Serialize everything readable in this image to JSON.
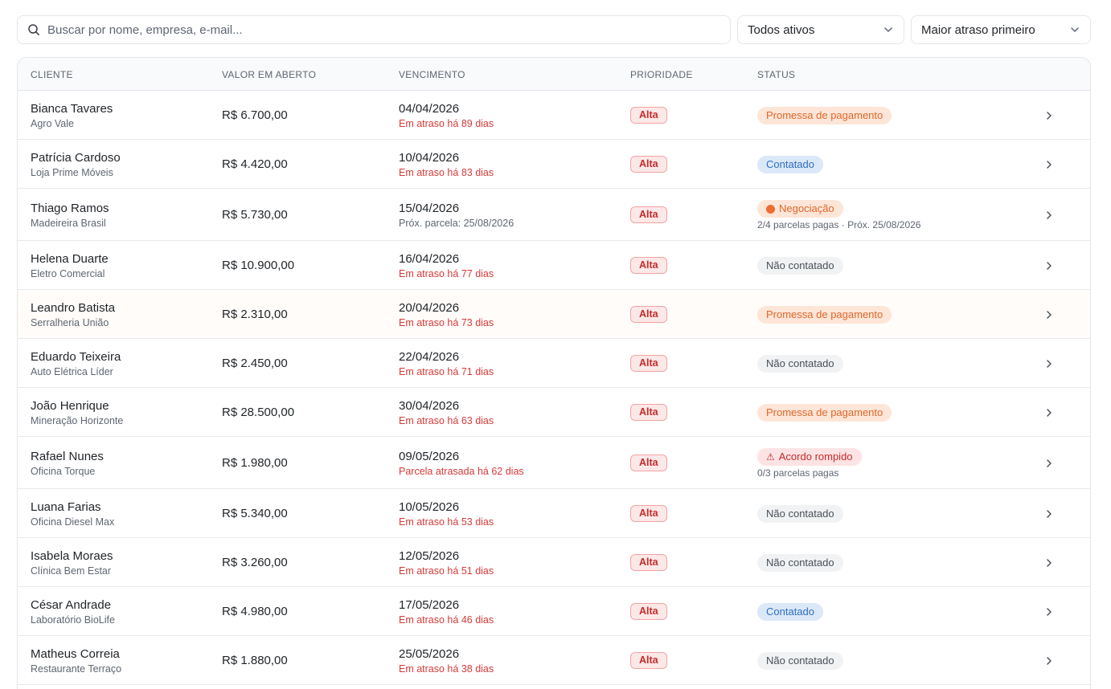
{
  "toolbar": {
    "search_placeholder": "Buscar por nome, empresa, e-mail...",
    "status_filter": "Todos ativos",
    "order_filter": "Maior atraso primeiro"
  },
  "columns": {
    "client": "CLIENTE",
    "amount": "VALOR EM ABERTO",
    "due": "VENCIMENTO",
    "priority": "PRIORIDADE",
    "status": "STATUS"
  },
  "rows": [
    {
      "name": "Bianca Tavares",
      "company": "Agro Vale",
      "amount": "R$ 6.700,00",
      "date": "04/04/2026",
      "due_note": "Em atraso há 89 dias",
      "due_tone": "red",
      "priority": "Alta",
      "status": "Promessa de pagamento",
      "status_kind": "promise",
      "status_sub": ""
    },
    {
      "name": "Patrícia Cardoso",
      "company": "Loja Prime Móveis",
      "amount": "R$ 4.420,00",
      "date": "10/04/2026",
      "due_note": "Em atraso há 83 dias",
      "due_tone": "red",
      "priority": "Alta",
      "status": "Contatado",
      "status_kind": "contacted",
      "status_sub": ""
    },
    {
      "name": "Thiago Ramos",
      "company": "Madeireira Brasil",
      "amount": "R$ 5.730,00",
      "date": "15/04/2026",
      "due_note": "Próx. parcela: 25/08/2026",
      "due_tone": "gray",
      "priority": "Alta",
      "status": "Negociação",
      "status_kind": "negot",
      "status_sub": "2/4 parcelas pagas · Próx. 25/08/2026"
    },
    {
      "name": "Helena Duarte",
      "company": "Eletro Comercial",
      "amount": "R$ 10.900,00",
      "date": "16/04/2026",
      "due_note": "Em atraso há 77 dias",
      "due_tone": "red",
      "priority": "Alta",
      "status": "Não contatado",
      "status_kind": "none",
      "status_sub": ""
    },
    {
      "name": "Leandro Batista",
      "company": "Serralheria União",
      "amount": "R$ 2.310,00",
      "date": "20/04/2026",
      "due_note": "Em atraso há 73 dias",
      "due_tone": "red",
      "priority": "Alta",
      "status": "Promessa de pagamento",
      "status_kind": "promise",
      "status_sub": ""
    },
    {
      "name": "Eduardo Teixeira",
      "company": "Auto Elétrica Líder",
      "amount": "R$ 2.450,00",
      "date": "22/04/2026",
      "due_note": "Em atraso há 71 dias",
      "due_tone": "red",
      "priority": "Alta",
      "status": "Não contatado",
      "status_kind": "none",
      "status_sub": ""
    },
    {
      "name": "João Henrique",
      "company": "Mineração Horizonte",
      "amount": "R$ 28.500,00",
      "date": "30/04/2026",
      "due_note": "Em atraso há 63 dias",
      "due_tone": "red",
      "priority": "Alta",
      "status": "Promessa de pagamento",
      "status_kind": "promise",
      "status_sub": ""
    },
    {
      "name": "Rafael Nunes",
      "company": "Oficina Torque",
      "amount": "R$ 1.980,00",
      "date": "09/05/2026",
      "due_note": "Parcela atrasada há 62 dias",
      "due_tone": "red",
      "priority": "Alta",
      "status": "Acordo rompido",
      "status_kind": "broken",
      "status_sub": "0/3 parcelas pagas"
    },
    {
      "name": "Luana Farias",
      "company": "Oficina Diesel Max",
      "amount": "R$ 5.340,00",
      "date": "10/05/2026",
      "due_note": "Em atraso há 53 dias",
      "due_tone": "red",
      "priority": "Alta",
      "status": "Não contatado",
      "status_kind": "none",
      "status_sub": ""
    },
    {
      "name": "Isabela Moraes",
      "company": "Clínica Bem Estar",
      "amount": "R$ 3.260,00",
      "date": "12/05/2026",
      "due_note": "Em atraso há 51 dias",
      "due_tone": "red",
      "priority": "Alta",
      "status": "Não contatado",
      "status_kind": "none",
      "status_sub": ""
    },
    {
      "name": "César Andrade",
      "company": "Laboratório BioLife",
      "amount": "R$ 4.980,00",
      "date": "17/05/2026",
      "due_note": "Em atraso há 46 dias",
      "due_tone": "red",
      "priority": "Alta",
      "status": "Contatado",
      "status_kind": "contacted",
      "status_sub": ""
    },
    {
      "name": "Matheus Correia",
      "company": "Restaurante Terraço",
      "amount": "R$ 1.880,00",
      "date": "25/05/2026",
      "due_note": "Em atraso há 38 dias",
      "due_tone": "red",
      "priority": "Alta",
      "status": "Não contatado",
      "status_kind": "none",
      "status_sub": ""
    }
  ],
  "colors": {
    "danger": "#d63a3a",
    "promise": "#e0662c",
    "contacted": "#2f6fbf",
    "border": "#e3e6ea"
  }
}
